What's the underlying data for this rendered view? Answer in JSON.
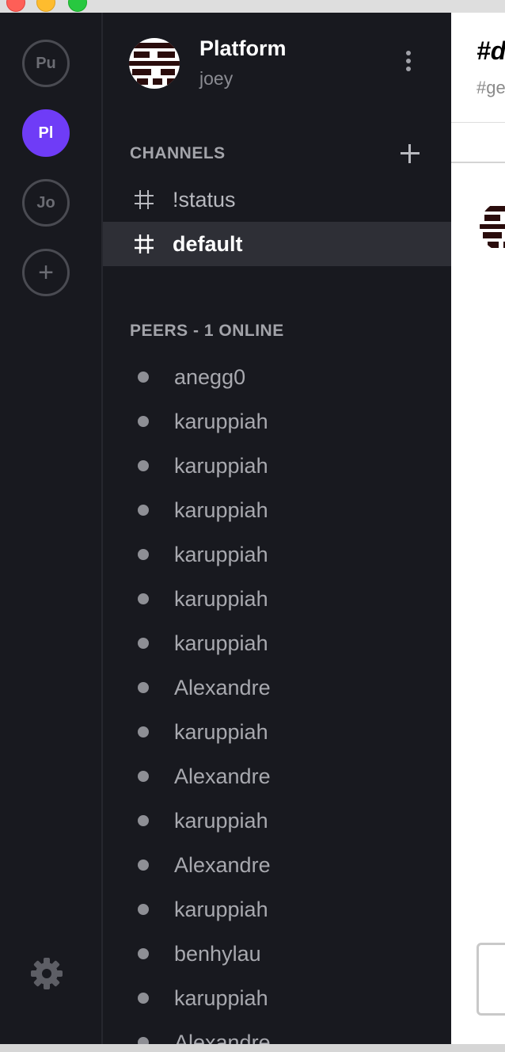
{
  "workspaces": [
    {
      "initials": "Pu",
      "active": false
    },
    {
      "initials": "Pl",
      "active": true
    },
    {
      "initials": "Jo",
      "active": false
    }
  ],
  "add_workspace_symbol": "+",
  "workspace": {
    "name": "Platform",
    "user": "joey"
  },
  "channels_header": "CHANNELS",
  "channels": [
    {
      "label": "!status",
      "active": false
    },
    {
      "label": "default",
      "active": true
    }
  ],
  "peers_header": "PEERS - 1 ONLINE",
  "peers": [
    "anegg0",
    "karuppiah",
    "karuppiah",
    "karuppiah",
    "karuppiah",
    "karuppiah",
    "karuppiah",
    "Alexandre",
    "karuppiah",
    "Alexandre",
    "karuppiah",
    "Alexandre",
    "karuppiah",
    "benhylau",
    "karuppiah",
    "Alexandre"
  ],
  "main": {
    "title": "#d",
    "subtitle": "#ge"
  },
  "colors": {
    "accent": "#6f3cf7",
    "sidebar_bg": "#18191f",
    "active_row": "#2e2f36"
  },
  "icons": {
    "settings": "gear-icon",
    "channel": "hash-icon",
    "menu": "kebab-icon",
    "add": "plus-icon"
  }
}
